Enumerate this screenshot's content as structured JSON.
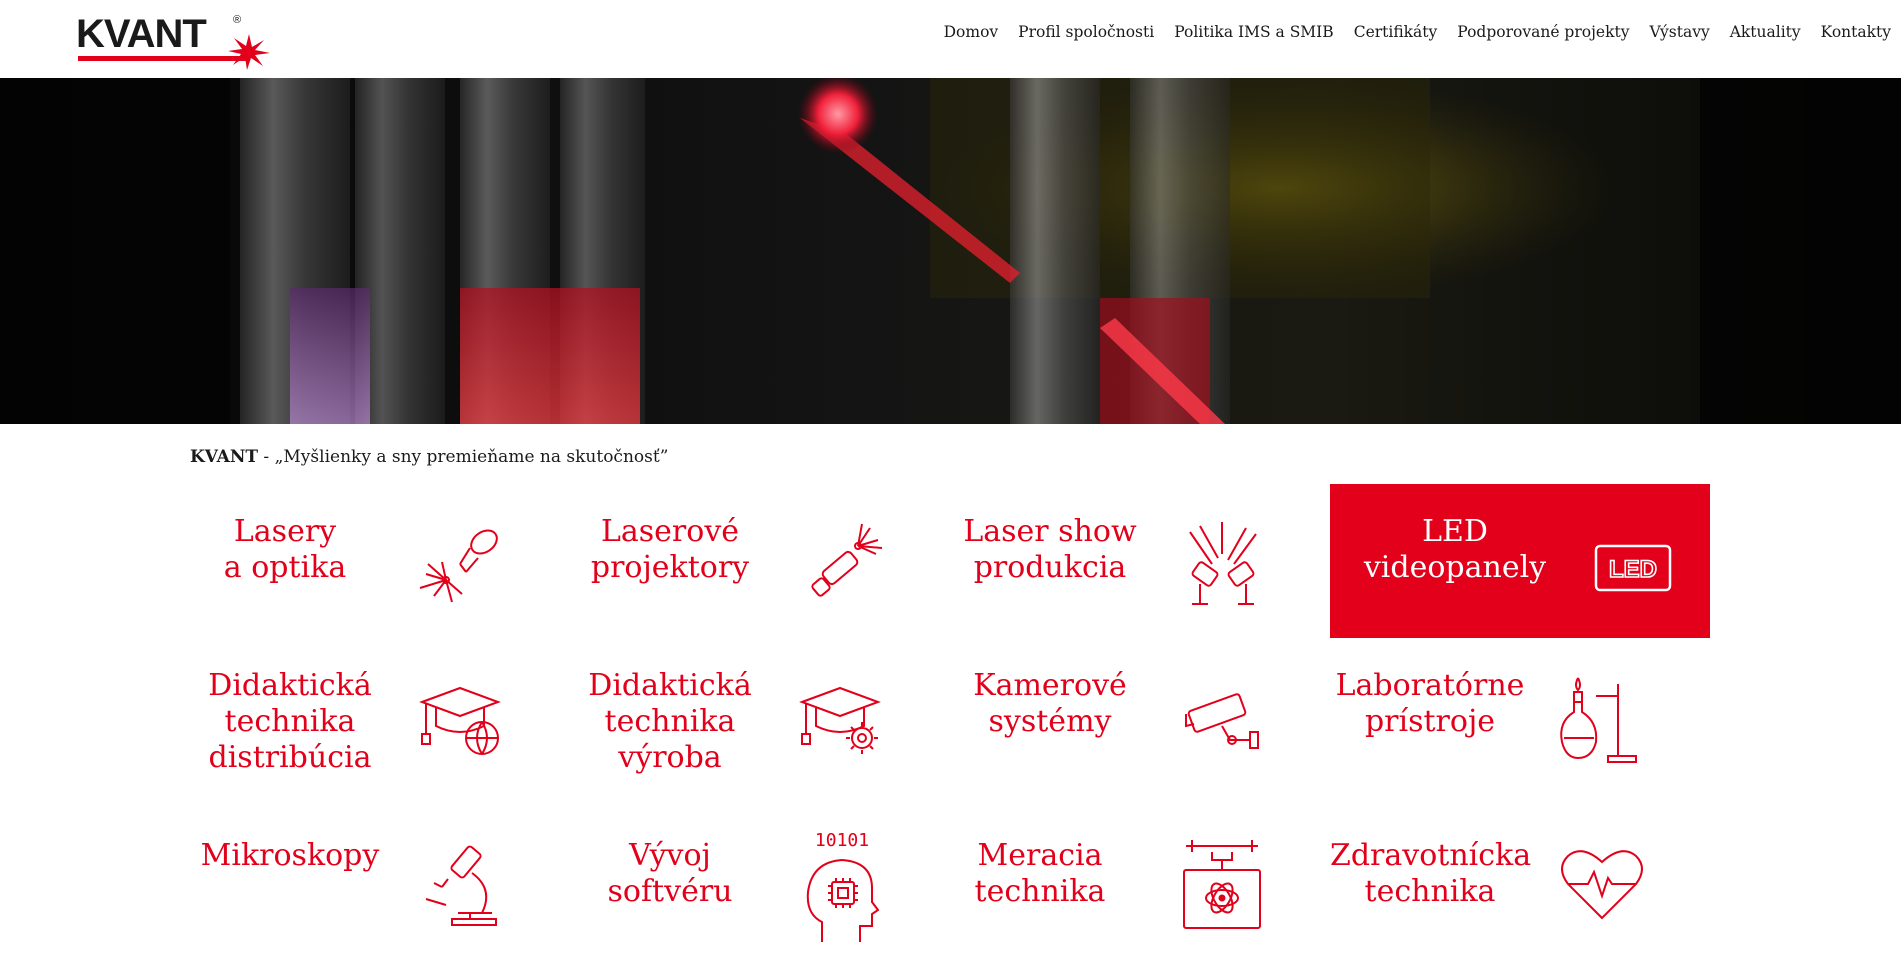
{
  "header": {
    "logo_text": "KVANT",
    "logo_mark": "®",
    "nav": [
      {
        "label": "Domov"
      },
      {
        "label": "Profil spoločnosti"
      },
      {
        "label": "Politika IMS a SMIB"
      },
      {
        "label": "Certifikáty"
      },
      {
        "label": "Podporované projekty"
      },
      {
        "label": "Výstavy"
      },
      {
        "label": "Aktuality"
      },
      {
        "label": "Kontakty"
      }
    ]
  },
  "intro": {
    "brand": "KVANT",
    "separator": " - ",
    "motto": "„Myšlienky a sny premieňame na skutočnosť”"
  },
  "colors": {
    "accent": "#e2001a",
    "text": "#1a1a1a",
    "background": "#ffffff"
  },
  "tiles": [
    {
      "line1": "Lasery",
      "line2": "a optika",
      "line3": "",
      "icon": "laser-burst-icon",
      "active": false
    },
    {
      "line1": "Laserové",
      "line2": "projektory",
      "line3": "",
      "icon": "laser-pointer-icon",
      "active": false
    },
    {
      "line1": "Laser show",
      "line2": "produkcia",
      "line3": "",
      "icon": "stage-spotlights-icon",
      "active": false
    },
    {
      "line1": "LED",
      "line2": "videopanely",
      "line3": "",
      "icon": "led-panel-icon",
      "icon_label": "LED",
      "active": true
    },
    {
      "line1": "Didaktická",
      "line2": "technika",
      "line3": "distribúcia",
      "icon": "graduation-cap-globe-icon",
      "active": false
    },
    {
      "line1": "Didaktická",
      "line2": "technika",
      "line3": "výroba",
      "icon": "graduation-cap-gear-icon",
      "active": false
    },
    {
      "line1": "Kamerové",
      "line2": "systémy",
      "line3": "",
      "icon": "security-camera-icon",
      "active": false
    },
    {
      "line1": "Laboratórne",
      "line2": "prístroje",
      "line3": "",
      "icon": "lab-flask-icon",
      "active": false
    },
    {
      "line1": "Mikroskopy",
      "line2": "",
      "line3": "",
      "icon": "microscope-icon",
      "active": false
    },
    {
      "line1": "Vývoj",
      "line2": "softvéru",
      "line3": "",
      "icon": "head-chip-icon",
      "icon_label": "10101",
      "active": false
    },
    {
      "line1": "Meracia",
      "line2": "technika",
      "line3": "",
      "icon": "measuring-device-icon",
      "active": false
    },
    {
      "line1": "Zdravotnícka",
      "line2": "technika",
      "line3": "",
      "icon": "heart-pulse-icon",
      "active": false
    }
  ]
}
